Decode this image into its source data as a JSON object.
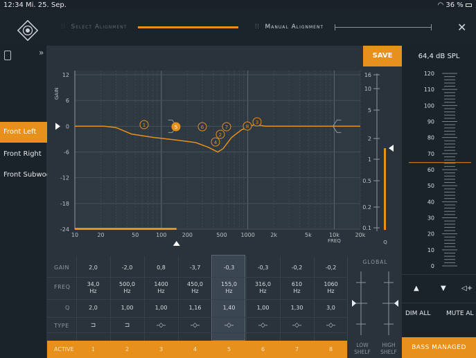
{
  "status": {
    "time": "12:34",
    "date": "Mi. 25. Sep.",
    "battery": "36 %"
  },
  "header": {
    "select_alignment": "Select Alignment",
    "manual_alignment": "Manual Alignment",
    "close_icon": "close-icon",
    "brand_color": "#e8901c"
  },
  "channels": [
    "Front Left",
    "Front Right",
    "Front Subwoofer"
  ],
  "active_channel": "Front Left",
  "save_label": "SAVE",
  "graph": {
    "gain_label": "GAIN",
    "freq_label": "FREQ",
    "q_label": "Q",
    "gain_ticks": [
      "12",
      "6",
      "0",
      "-6",
      "-12",
      "-18",
      "-24"
    ],
    "freq_ticks": [
      "10",
      "20",
      "50",
      "100",
      "200",
      "500",
      "1000",
      "2k",
      "5k",
      "10k",
      "20k"
    ],
    "q_ticks": [
      "16",
      "10",
      "5",
      "2",
      "1",
      "0.5",
      "0.2",
      "0.1"
    ],
    "band_markers": [
      "1",
      "2",
      "3",
      "4",
      "5",
      "6",
      "7",
      "8"
    ]
  },
  "table": {
    "row_labels": [
      "GAIN",
      "FREQ",
      "Q",
      "TYPE",
      "ACTIVE"
    ],
    "bands": [
      {
        "gain": "2,0",
        "freq": "34,0",
        "unit": "Hz",
        "q": "2,0",
        "type": "shelf",
        "n": "1"
      },
      {
        "gain": "-2,0",
        "freq": "500,0",
        "unit": "Hz",
        "q": "1,00",
        "type": "shelf",
        "n": "2"
      },
      {
        "gain": "0,8",
        "freq": "1400",
        "unit": "Hz",
        "q": "1,00",
        "type": "peak",
        "n": "3"
      },
      {
        "gain": "-3,7",
        "freq": "450,0",
        "unit": "Hz",
        "q": "1,16",
        "type": "peak",
        "n": "4"
      },
      {
        "gain": "-0,3",
        "freq": "155,0",
        "unit": "Hz",
        "q": "1,40",
        "type": "peak",
        "n": "5"
      },
      {
        "gain": "-0,3",
        "freq": "316,0",
        "unit": "Hz",
        "q": "1,00",
        "type": "peak",
        "n": "6"
      },
      {
        "gain": "-0,2",
        "freq": "610",
        "unit": "Hz",
        "q": "1,30",
        "type": "peak",
        "n": "7"
      },
      {
        "gain": "-0,2",
        "freq": "1060",
        "unit": "Hz",
        "q": "3,0",
        "type": "peak",
        "n": "8"
      }
    ],
    "global_label": "GLOBAL",
    "low_shelf": "LOW SHELF",
    "high_shelf": "HIGH SHELF"
  },
  "meter": {
    "spl_readout": "64,4 dB SPL",
    "ticks": [
      "120",
      "110",
      "100",
      "90",
      "80",
      "70",
      "60",
      "50",
      "40",
      "30",
      "20",
      "10",
      "0"
    ]
  },
  "controls": {
    "dim_all": "DIM ALL",
    "mute_all": "MUTE AL",
    "bass_managed": "BASS MANAGED"
  }
}
